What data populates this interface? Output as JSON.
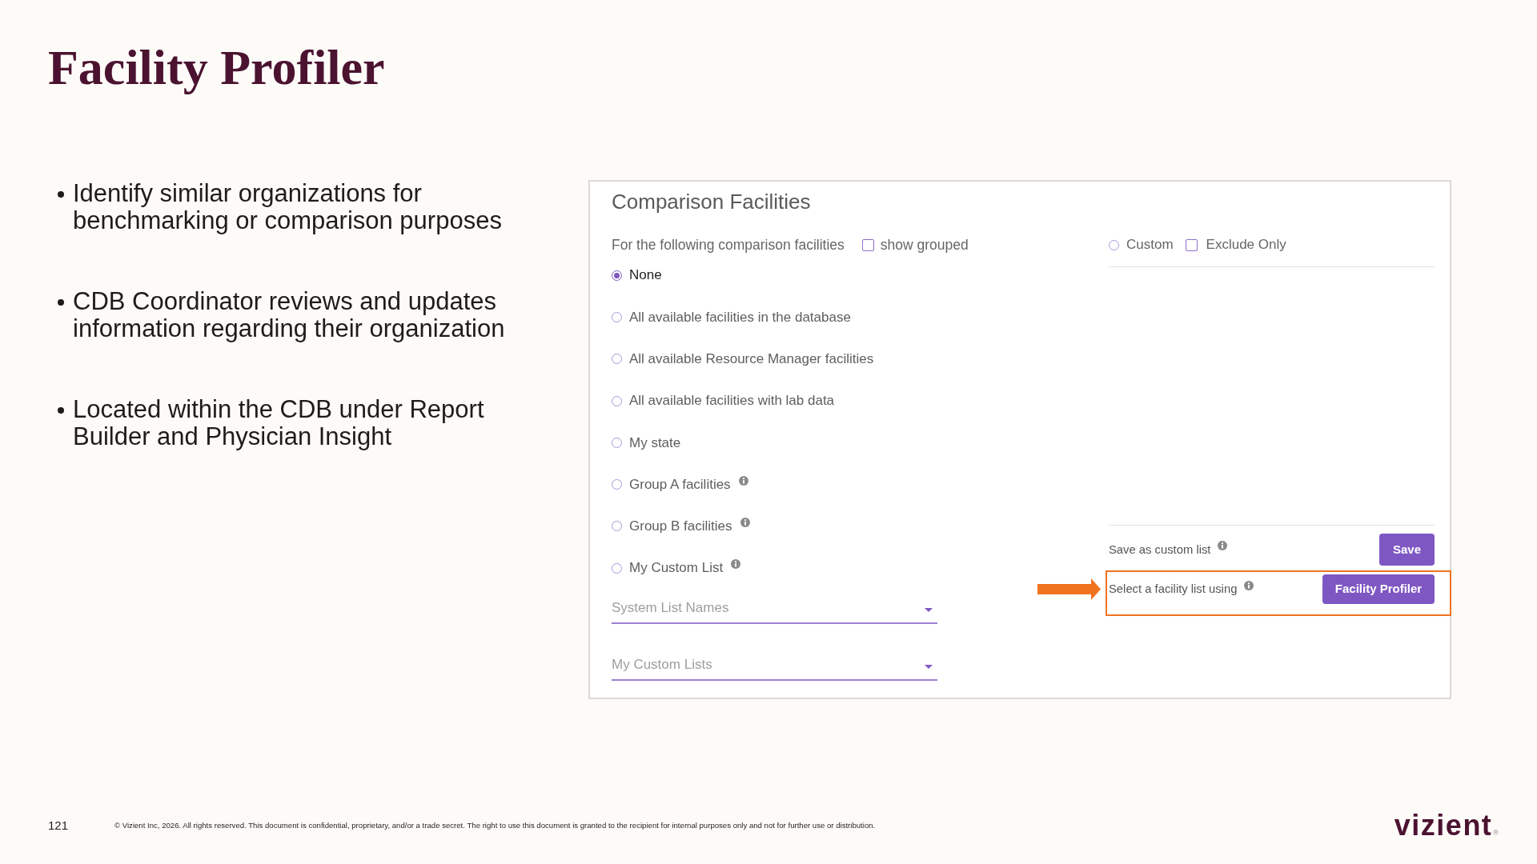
{
  "slide": {
    "title": "Facility Profiler",
    "bullets": [
      "Identify similar organizations for benchmarking or comparison purposes",
      "CDB Coordinator reviews and updates information regarding their organization",
      "Located within the CDB under Report Builder and Physician Insight"
    ]
  },
  "panel": {
    "title": "Comparison Facilities",
    "prompt": "For the following comparison facilities",
    "show_grouped": {
      "label": "show grouped",
      "checked": false
    },
    "custom": {
      "label": "Custom",
      "selected": false
    },
    "exclude_only": {
      "label": "Exclude Only",
      "checked": false
    },
    "options": [
      {
        "label": "None",
        "selected": true,
        "info": false
      },
      {
        "label": "All available facilities in the database",
        "selected": false,
        "info": false
      },
      {
        "label": "All available Resource Manager facilities",
        "selected": false,
        "info": false
      },
      {
        "label": "All available facilities with lab data",
        "selected": false,
        "info": false
      },
      {
        "label": "My state",
        "selected": false,
        "info": false
      },
      {
        "label": "Group A facilities",
        "selected": false,
        "info": true
      },
      {
        "label": "Group B facilities",
        "selected": false,
        "info": true
      },
      {
        "label": "My Custom List",
        "selected": false,
        "info": true
      }
    ],
    "dropdowns": [
      {
        "placeholder": "System List Names"
      },
      {
        "placeholder": "My Custom Lists"
      }
    ],
    "save_row": {
      "label": "Save as custom list",
      "info": true,
      "button": "Save"
    },
    "profiler_row": {
      "label": "Select a facility list using",
      "info": true,
      "button": "Facility Profiler",
      "highlighted": true
    }
  },
  "footer": {
    "page_number": "121",
    "copyright": "© Vizient Inc, 2026. All rights reserved. This document is confidential, proprietary, and/or a trade secret. The right to use this document is granted to the recipient for internal purposes only and not for further use or distribution.",
    "logo": {
      "text": "vizient",
      "mark": "®"
    }
  }
}
